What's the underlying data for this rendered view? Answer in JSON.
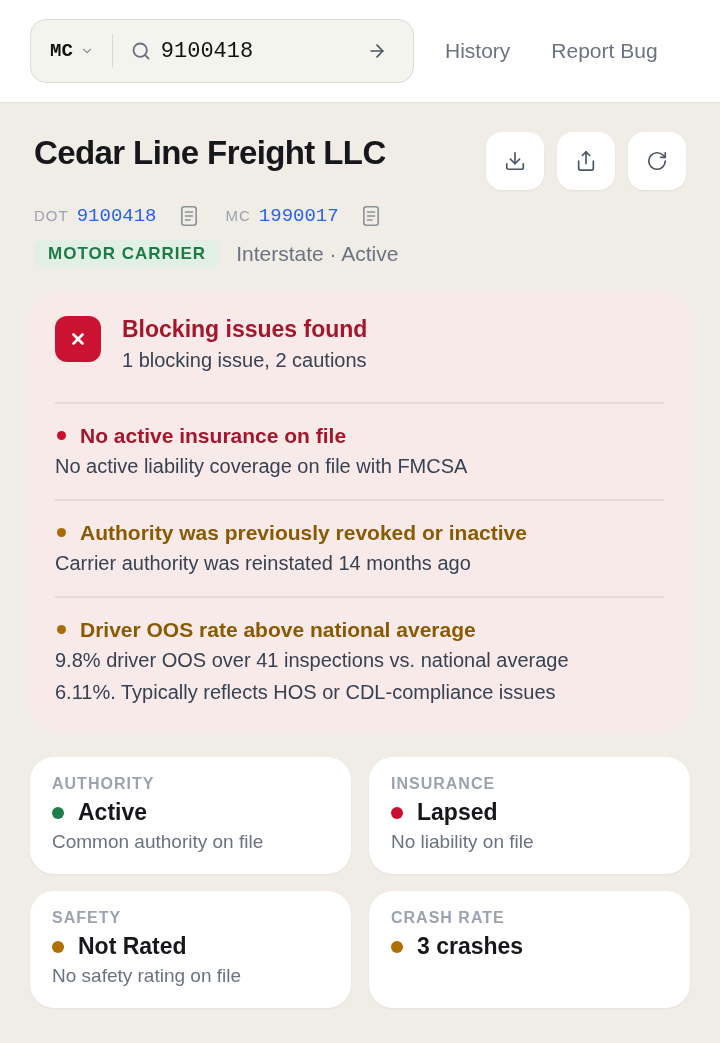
{
  "search": {
    "type_selector": "MC",
    "value": "9100418"
  },
  "nav": [
    "History",
    "Report Bug"
  ],
  "carrier": {
    "name": "Cedar Line Freight LLC",
    "identifiers": [
      {
        "label": "DOT",
        "value": "9100418"
      },
      {
        "label": "MC",
        "value": "1990017"
      }
    ],
    "badge": "MOTOR CARRIER",
    "summary": "Interstate · Active"
  },
  "alert": {
    "title": "Blocking issues found",
    "subtitle": "1 blocking issue, 2 cautions",
    "issues": [
      {
        "kind": "blocking",
        "title": "No active insurance on file",
        "description": "No active liability coverage on file with FMCSA"
      },
      {
        "kind": "caution",
        "title": "Authority was previously revoked or inactive",
        "description": "Carrier authority was reinstated 14 months ago"
      },
      {
        "kind": "caution",
        "title": "Driver OOS rate above national average",
        "description": "9.8% driver OOS over 41 inspections vs. national average 6.11%. Typically reflects HOS or CDL-compliance issues"
      }
    ]
  },
  "cards": [
    {
      "label": "AUTHORITY",
      "value": "Active",
      "color": "#1e7d4b",
      "note": "Common authority on file"
    },
    {
      "label": "INSURANCE",
      "value": "Lapsed",
      "color": "#c8102e",
      "note": "No liability on file"
    },
    {
      "label": "SAFETY",
      "value": "Not Rated",
      "color": "#b06f00",
      "note": "No safety rating on file"
    },
    {
      "label": "CRASH RATE",
      "value": "3 crashes",
      "color": "#b06f00"
    }
  ]
}
